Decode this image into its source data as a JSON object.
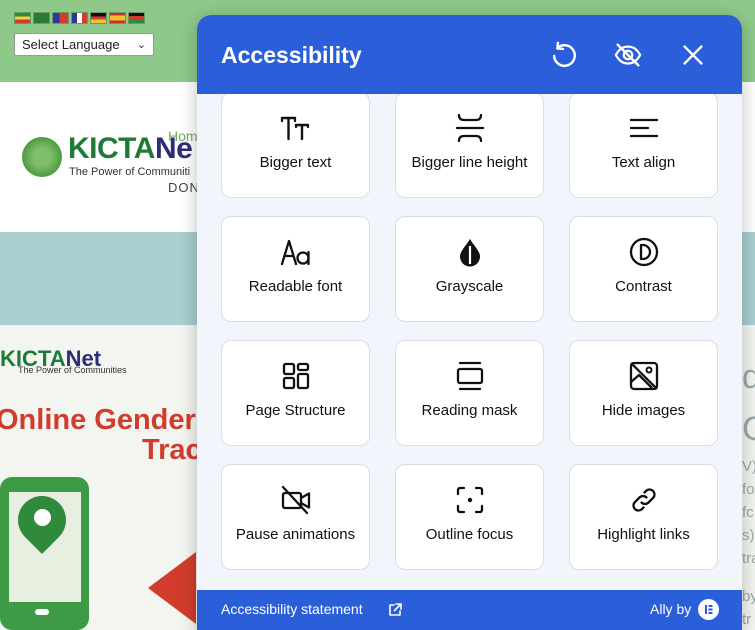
{
  "site": {
    "language_select": {
      "value": "Select Language"
    },
    "flags": [
      "ethiopia",
      "saudi-arabia",
      "taiwan",
      "france",
      "germany",
      "spain",
      "kenya"
    ],
    "header": {
      "logo_brand_green": "KICTA",
      "logo_brand_blue": "Ne",
      "logo_tagline": "The Power of Communiti",
      "home_link": "Hom",
      "donate_text": "DON"
    },
    "banner": {
      "logo_green": "KICTA",
      "logo_blue": "Net",
      "logo_tagline": "The Power of Communities",
      "title_line1": "Online Gender-",
      "title_line2": "Trac"
    },
    "right_edge_fragments": [
      "d",
      "C",
      "V)",
      "fo",
      "fc",
      "s)",
      "tra",
      "by",
      "tr"
    ]
  },
  "widget": {
    "title": "Accessibility",
    "header_icons": [
      "reset-icon",
      "hide-widget-icon",
      "close-icon"
    ],
    "tiles": [
      {
        "label": "Bigger text",
        "icon": "bigger-text-icon"
      },
      {
        "label": "Bigger line height",
        "icon": "line-height-icon"
      },
      {
        "label": "Text align",
        "icon": "text-align-icon"
      },
      {
        "label": "Readable font",
        "icon": "readable-font-icon"
      },
      {
        "label": "Grayscale",
        "icon": "grayscale-icon"
      },
      {
        "label": "Contrast",
        "icon": "contrast-icon"
      },
      {
        "label": "Page Structure",
        "icon": "page-structure-icon"
      },
      {
        "label": "Reading mask",
        "icon": "reading-mask-icon"
      },
      {
        "label": "Hide images",
        "icon": "hide-images-icon"
      },
      {
        "label": "Pause animations",
        "icon": "pause-animations-icon"
      },
      {
        "label": "Outline focus",
        "icon": "outline-focus-icon"
      },
      {
        "label": "Highlight links",
        "icon": "highlight-links-icon"
      }
    ],
    "footer": {
      "statement_link": "Accessibility statement",
      "ally_by": "Ally by"
    },
    "colors": {
      "primary": "#2b5fd9",
      "tile_bg": "#ffffff",
      "grid_bg": "#f2f5fb"
    }
  }
}
